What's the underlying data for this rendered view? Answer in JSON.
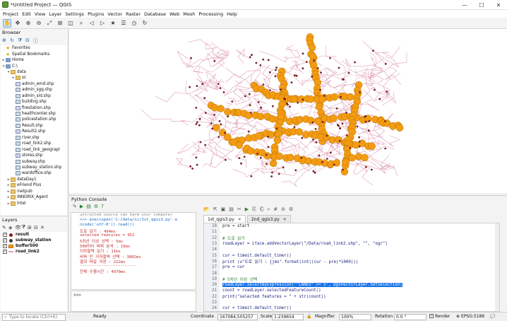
{
  "window": {
    "title": "*Untitled Project — QGIS",
    "controls": [
      "—",
      "☐",
      "✕"
    ]
  },
  "menu": [
    "Project",
    "Edit",
    "View",
    "Layer",
    "Settings",
    "Plugins",
    "Vector",
    "Raster",
    "Database",
    "Web",
    "Mesh",
    "Processing",
    "Help"
  ],
  "toolbar_icons": [
    "pan-hand",
    "pan-to-selection",
    "zoom-in",
    "zoom-out",
    "zoom-full",
    "zoom-selection",
    "zoom-layer",
    "zoom-native",
    "zoom-last",
    "zoom-next",
    "new-bookmark",
    "show-bookmarks",
    "temporal-controller",
    "refresh"
  ],
  "browser": {
    "title": "Browser",
    "items": [
      {
        "label": "Favorites",
        "icon": "star",
        "indent": 1
      },
      {
        "label": "Spatial Bookmarks",
        "icon": "bookmark",
        "indent": 1
      },
      {
        "label": "Home",
        "icon": "home",
        "indent": 1
      },
      {
        "label": "C:\\",
        "icon": "drive",
        "indent": 1,
        "expanded": true
      },
      {
        "label": "data",
        "icon": "folder",
        "indent": 2,
        "expanded": true
      },
      {
        "label": "sc",
        "icon": "folder",
        "indent": 3
      },
      {
        "label": "admin_emd.shp",
        "icon": "shp",
        "indent": 3
      },
      {
        "label": "admin_sgg.shp",
        "icon": "shp",
        "indent": 3
      },
      {
        "label": "admin_sid.shp",
        "icon": "shp",
        "indent": 3
      },
      {
        "label": "building.shp",
        "icon": "shp",
        "indent": 3
      },
      {
        "label": "firestation.shp",
        "icon": "shp",
        "indent": 3
      },
      {
        "label": "healthcenter.shp",
        "icon": "shp",
        "indent": 3
      },
      {
        "label": "policestation.shp",
        "icon": "shp",
        "indent": 3
      },
      {
        "label": "Result.shp",
        "icon": "shp",
        "indent": 3
      },
      {
        "label": "Result2.shp",
        "icon": "shp",
        "indent": 3
      },
      {
        "label": "river.shp",
        "icon": "shp",
        "indent": 3
      },
      {
        "label": "road_link2.shp",
        "icon": "shp",
        "indent": 3
      },
      {
        "label": "road_link_geograpl",
        "icon": "shp",
        "indent": 3
      },
      {
        "label": "stores.shp",
        "icon": "shp",
        "indent": 3
      },
      {
        "label": "subway.shp",
        "icon": "shp",
        "indent": 3
      },
      {
        "label": "subway_station.shp",
        "icon": "shp",
        "indent": 3
      },
      {
        "label": "wardoffice.shp",
        "icon": "shp",
        "indent": 3
      },
      {
        "label": "dataDay1",
        "icon": "folder",
        "indent": 2
      },
      {
        "label": "eFriend Plus",
        "icon": "folder",
        "indent": 2
      },
      {
        "label": "inetpub",
        "icon": "folder",
        "indent": 2
      },
      {
        "label": "INNORIX_Agent",
        "icon": "folder",
        "indent": 2
      },
      {
        "label": "Intel",
        "icon": "folder",
        "indent": 2
      }
    ]
  },
  "layers": {
    "title": "Layers",
    "items": [
      {
        "label": "result",
        "checked": true,
        "symbol": "dot",
        "color": "#8b1a1a"
      },
      {
        "label": "subway_station",
        "checked": true,
        "symbol": "dot",
        "color": "#3a3a3a"
      },
      {
        "label": "buffer500",
        "checked": true,
        "symbol": "fill",
        "color": "#f39c12"
      },
      {
        "label": "road_link2",
        "checked": true,
        "symbol": "line",
        "color": "#e0a0b8"
      }
    ]
  },
  "console": {
    "title": "Python Console",
    "output": [
      {
        "text": "untrusted source can harm your computer",
        "style": "gray"
      },
      {
        "text": ">>> exec(open('C:/data/sc/1st_qgis3.py'.e",
        "style": "blue"
      },
      {
        "text": "ncode('utf-8')).read())",
        "style": "blue"
      },
      {
        "text": "도로 읽기 : 494ms",
        "style": "red"
      },
      {
        "text": "selected features = 951",
        "style": "red"
      },
      {
        "text": "5차선 이상 선택 : 5ms",
        "style": "red"
      },
      {
        "text": "500미터 버퍼 분석 : 19ms",
        "style": "red"
      },
      {
        "text": "지하철역 읽기 : 11ms",
        "style": "red"
      },
      {
        "text": "버퍼 안 지하철역 선택 : 3802ms",
        "style": "red"
      },
      {
        "text": "결과 파일 저장 : 222ms",
        "style": "red"
      },
      {
        "text": "------------------------",
        "style": "red"
      },
      {
        "text": "전체 수행시간 : 4970ms",
        "style": "red"
      }
    ],
    "prompt": ">>>",
    "tabs": [
      {
        "label": "1st_qgis3.py",
        "active": true
      },
      {
        "label": "2nd_qgis3.py",
        "active": false
      }
    ],
    "editor_lines": [
      {
        "n": "10",
        "text": "pre = start",
        "kind": "plain"
      },
      {
        "n": "11",
        "text": "",
        "kind": "plain"
      },
      {
        "n": "12",
        "text": "# 도로 읽기",
        "kind": "comment"
      },
      {
        "n": "13",
        "text": "roadLayer = iface.addVectorLayer(\"/Data/road_link2.shp\", \"\", \"ogr\")",
        "kind": "code"
      },
      {
        "n": "14",
        "text": "",
        "kind": "plain"
      },
      {
        "n": "15",
        "text": "cur = timeit.default_timer()",
        "kind": "code"
      },
      {
        "n": "16",
        "text": "print (u\"도로 읽기 : {}ms\".format(int((cur - pre)*1000)))",
        "kind": "code"
      },
      {
        "n": "17",
        "text": "pre = cur",
        "kind": "code"
      },
      {
        "n": "18",
        "text": "",
        "kind": "plain"
      },
      {
        "n": "19",
        "text": "# 5차선 이상 선택",
        "kind": "comment"
      },
      {
        "n": "20",
        "text": "roadLayer.selectByExpression('\"LANES\" >= 5', QgsVectorLayer.SetSelection)",
        "kind": "code",
        "highlight": true
      },
      {
        "n": "21",
        "text": "count = roadLayer.selectedFeatureCount()",
        "kind": "code"
      },
      {
        "n": "22",
        "text": "print(\"selected features = \" + str(count))",
        "kind": "code"
      },
      {
        "n": "23",
        "text": "",
        "kind": "plain"
      },
      {
        "n": "24",
        "text": "cur = timeit.default_timer()",
        "kind": "code"
      }
    ]
  },
  "locator": {
    "placeholder": "Type to locate (Ctrl+K)"
  },
  "statusbar": {
    "ready": "Ready",
    "coordinate_label": "Coordinate",
    "coordinate": "167084,505257",
    "scale_label": "Scale",
    "scale": "1:239654",
    "magnifier_label": "Magnifier",
    "magnifier": "100%",
    "rotation_label": "Rotation",
    "rotation": "0.0 °",
    "render_label": "Render",
    "crs": "EPSG:5186"
  },
  "colors": {
    "buffer": "#f39c12",
    "buffer_stroke": "#b86f00",
    "road": "#e0a0b8",
    "station": "#7a1f1f",
    "highlight": "#1a73e8"
  }
}
